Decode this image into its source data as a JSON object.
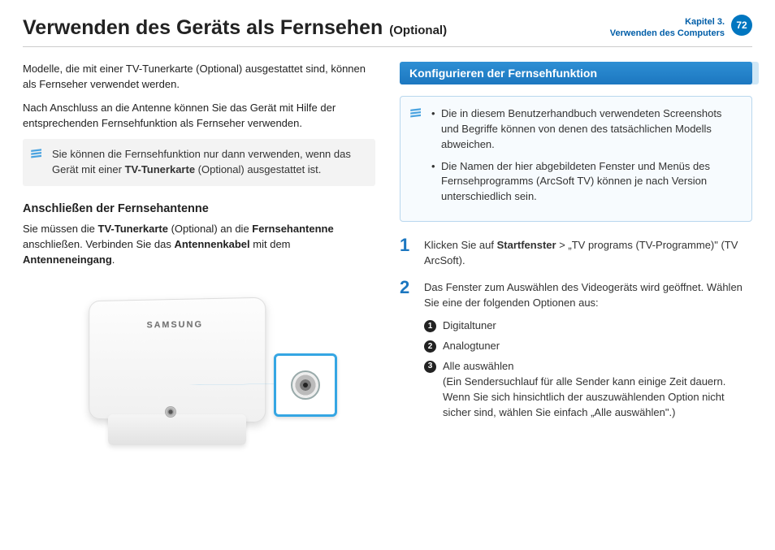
{
  "header": {
    "title": "Verwenden des Geräts als Fernsehen",
    "suffix": "(Optional)",
    "chapter_label": "Kapitel 3.",
    "chapter_title": "Verwenden des Computers",
    "page_number": "72"
  },
  "left": {
    "intro1": "Modelle, die mit einer TV-Tunerkarte (Optional) ausgestattet sind, können als Fernseher verwendet werden.",
    "intro2": "Nach Anschluss an die Antenne können Sie das Gerät mit Hilfe der entsprechenden Fernsehfunktion als Fernseher verwenden.",
    "note_pre": "Sie können die Fernsehfunktion nur dann verwenden, wenn das Gerät mit einer ",
    "note_bold": "TV-Tunerkarte",
    "note_post": " (Optional) ausgestattet ist.",
    "subhead": "Anschließen der Fernsehantenne",
    "connect_1": "Sie müssen die ",
    "connect_b1": "TV-Tunerkarte",
    "connect_2": " (Optional) an die ",
    "connect_b2": "Fernsehantenne",
    "connect_3": " anschließen. Verbinden Sie das ",
    "connect_b3": "Antennenkabel",
    "connect_4": " mit dem ",
    "connect_b4": "Antenneneingang",
    "connect_5": ".",
    "logo": "SAMSUNG"
  },
  "right": {
    "section_title": "Konfigurieren der Fernsehfunktion",
    "info1": "Die in diesem Benutzerhandbuch verwendeten Screenshots und Begriffe können von denen des tatsächlichen Modells abweichen.",
    "info2": "Die Namen der hier abgebildeten Fenster und Menüs des Fernsehprogramms (ArcSoft TV) können je nach Version unterschiedlich sein.",
    "step1_pre": "Klicken Sie auf ",
    "step1_bold": "Startfenster",
    "step1_post": " > „TV programs (TV-Programme)\" (TV ArcSoft).",
    "step2": "Das Fenster zum Auswählen des Videogeräts wird geöffnet. Wählen Sie eine der folgenden Optionen aus:",
    "opt1": "Digitaltuner",
    "opt2": "Analogtuner",
    "opt3": "Alle auswählen",
    "opt3_note": "(Ein Sendersuchlauf für alle Sender kann einige Zeit dauern. Wenn Sie sich hinsichtlich der auszuwählenden Option nicht sicher sind, wählen Sie einfach „Alle auswählen\".)"
  }
}
